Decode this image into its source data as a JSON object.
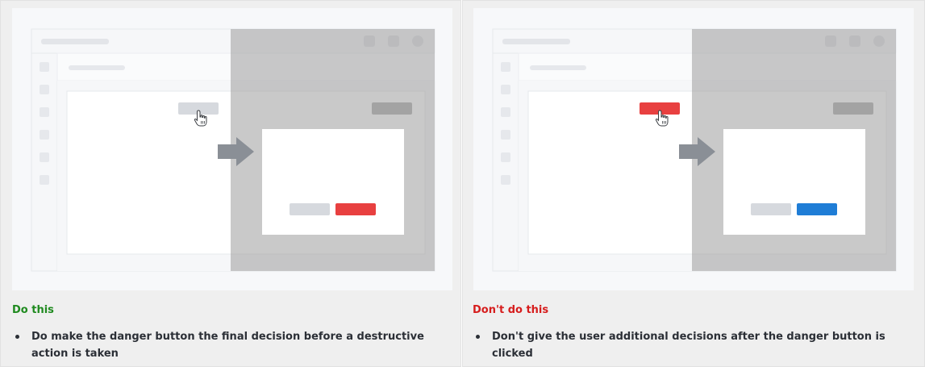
{
  "panels": [
    {
      "id": "do",
      "heading": "Do this",
      "heading_color": "#1f8a1f",
      "tips": [
        "Do make the danger button the final decision before a destructive action is taken"
      ],
      "trigger_button_color": "#d6d9de",
      "dialog_primary_button_color": "#e84040"
    },
    {
      "id": "dont",
      "heading": "Don't do this",
      "heading_color": "#d61d1d",
      "tips": [
        "Don't give the user additional decisions after the danger button is clicked"
      ],
      "trigger_button_color": "#e84040",
      "dialog_primary_button_color": "#1f7dd6"
    }
  ],
  "icons": {
    "cursor": "hand-pointer-icon",
    "arrow": "arrow-right-icon"
  }
}
